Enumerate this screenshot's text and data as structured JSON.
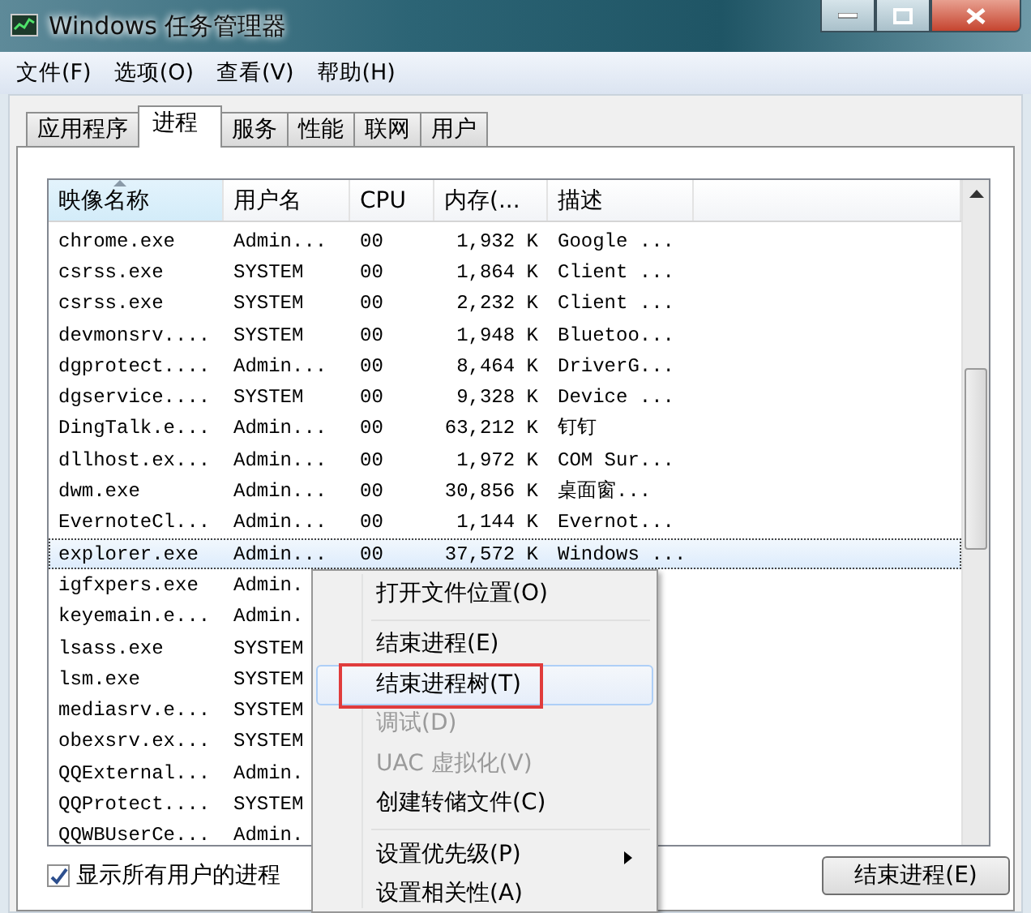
{
  "window": {
    "title": "Windows 任务管理器"
  },
  "menu": [
    "文件(F)",
    "选项(O)",
    "查看(V)",
    "帮助(H)"
  ],
  "tabs": [
    {
      "label": "应用程序",
      "selected": false
    },
    {
      "label": "进程",
      "selected": true
    },
    {
      "label": "服务",
      "selected": false
    },
    {
      "label": "性能",
      "selected": false
    },
    {
      "label": "联网",
      "selected": false
    },
    {
      "label": "用户",
      "selected": false
    }
  ],
  "table": {
    "columns": [
      {
        "label": "映像名称",
        "sorted": true
      },
      {
        "label": "用户名",
        "sorted": false
      },
      {
        "label": "CPU",
        "sorted": false
      },
      {
        "label": "内存(...",
        "sorted": false
      },
      {
        "label": "描述",
        "sorted": false
      }
    ],
    "rows": [
      {
        "cells": [
          "chrome.exe",
          "Admin...",
          "00",
          "1,932 K",
          "Google ..."
        ],
        "selected": false
      },
      {
        "cells": [
          "csrss.exe",
          "SYSTEM",
          "00",
          "1,864 K",
          "Client ..."
        ],
        "selected": false
      },
      {
        "cells": [
          "csrss.exe",
          "SYSTEM",
          "00",
          "2,232 K",
          "Client ..."
        ],
        "selected": false
      },
      {
        "cells": [
          "devmonsrv....",
          "SYSTEM",
          "00",
          "1,948 K",
          "Bluetoo..."
        ],
        "selected": false
      },
      {
        "cells": [
          "dgprotect....",
          "Admin...",
          "00",
          "8,464 K",
          "DriverG..."
        ],
        "selected": false
      },
      {
        "cells": [
          "dgservice....",
          "SYSTEM",
          "00",
          "9,328 K",
          "Device ..."
        ],
        "selected": false
      },
      {
        "cells": [
          "DingTalk.e...",
          "Admin...",
          "00",
          "63,212 K",
          "钉钉"
        ],
        "selected": false
      },
      {
        "cells": [
          "dllhost.ex...",
          "Admin...",
          "00",
          "1,972 K",
          "COM Sur..."
        ],
        "selected": false
      },
      {
        "cells": [
          "dwm.exe",
          "Admin...",
          "00",
          "30,856 K",
          "桌面窗..."
        ],
        "selected": false
      },
      {
        "cells": [
          "EvernoteCl...",
          "Admin...",
          "00",
          "1,144 K",
          "Evernot..."
        ],
        "selected": false
      },
      {
        "cells": [
          "explorer.exe",
          "Admin...",
          "00",
          "37,572 K",
          "Windows ..."
        ],
        "selected": true
      },
      {
        "cells": [
          "igfxpers.exe",
          "Admin."
        ],
        "selected": false
      },
      {
        "cells": [
          "keyemain.e...",
          "Admin."
        ],
        "selected": false
      },
      {
        "cells": [
          "lsass.exe",
          "SYSTEM"
        ],
        "selected": false
      },
      {
        "cells": [
          "lsm.exe",
          "SYSTEM"
        ],
        "selected": false
      },
      {
        "cells": [
          "mediasrv.e...",
          "SYSTEM"
        ],
        "selected": false
      },
      {
        "cells": [
          "obexsrv.ex...",
          "SYSTEM"
        ],
        "selected": false
      },
      {
        "cells": [
          "QQExternal...",
          "Admin."
        ],
        "selected": false
      },
      {
        "cells": [
          "QQProtect....",
          "SYSTEM"
        ],
        "selected": false
      },
      {
        "cells": [
          "QQWBUserCe...",
          "Admin."
        ],
        "selected": false
      }
    ]
  },
  "show_all_users": {
    "label": "显示所有用户的进程",
    "checked": true
  },
  "end_button": "结束进程(E)",
  "context_menu": {
    "items": [
      {
        "kind": "item",
        "label": "打开文件位置(O)",
        "disabled": false,
        "highlighted": false,
        "annotated": false
      },
      {
        "kind": "separator"
      },
      {
        "kind": "item",
        "label": "结束进程(E)",
        "disabled": false,
        "highlighted": false,
        "annotated": false
      },
      {
        "kind": "item",
        "label": "结束进程树(T)",
        "disabled": false,
        "highlighted": true,
        "annotated": true
      },
      {
        "kind": "item",
        "label": "调试(D)",
        "disabled": true,
        "highlighted": false,
        "annotated": false
      },
      {
        "kind": "item",
        "label": "UAC 虚拟化(V)",
        "disabled": true,
        "highlighted": false,
        "annotated": false
      },
      {
        "kind": "item",
        "label": "创建转储文件(C)",
        "disabled": false,
        "highlighted": false,
        "annotated": false
      },
      {
        "kind": "separator"
      },
      {
        "kind": "item",
        "label": "设置优先级(P)",
        "disabled": false,
        "highlighted": false,
        "annotated": false,
        "submenu": true
      },
      {
        "kind": "item",
        "label": "设置相关性(A)",
        "disabled": false,
        "highlighted": false,
        "annotated": false
      }
    ]
  }
}
